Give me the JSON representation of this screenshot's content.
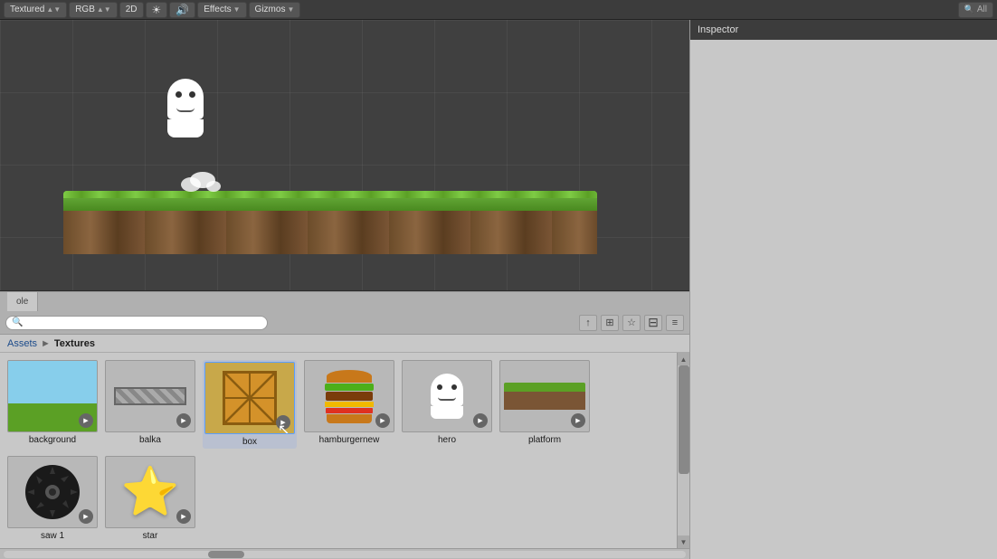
{
  "toolbar": {
    "textured_label": "Textured",
    "rgb_label": "RGB",
    "mode_2d": "2D",
    "effects_label": "Effects",
    "gizmos_label": "Gizmos",
    "search_placeholder": "All"
  },
  "inspector": {
    "title": "Inspector"
  },
  "bottom_panel": {
    "tab_label": "ole",
    "breadcrumb_assets": "Assets",
    "breadcrumb_sep": "►",
    "breadcrumb_textures": "Textures"
  },
  "assets": [
    {
      "id": "background",
      "name": "background",
      "type": "background"
    },
    {
      "id": "balka",
      "name": "balka",
      "type": "balka"
    },
    {
      "id": "box",
      "name": "box",
      "type": "box"
    },
    {
      "id": "hamburgernew",
      "name": "hamburgernew",
      "type": "burger"
    },
    {
      "id": "hero",
      "name": "hero",
      "type": "hero"
    },
    {
      "id": "platform",
      "name": "platform",
      "type": "platform"
    },
    {
      "id": "saw1",
      "name": "saw 1",
      "type": "saw"
    },
    {
      "id": "star",
      "name": "star",
      "type": "star"
    }
  ],
  "icons": {
    "play": "▶",
    "search": "🔍",
    "arrow_right": "►",
    "arrow_up": "▲",
    "arrow_down": "▼",
    "bookmark": "☆",
    "tag": "⊞",
    "lock": "⊡",
    "minimize": "−",
    "close": "×"
  }
}
